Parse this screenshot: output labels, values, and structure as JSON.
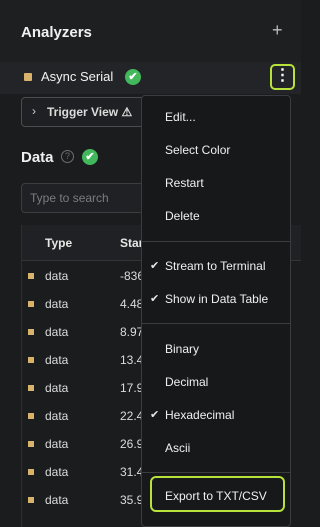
{
  "analyzers": {
    "title": "Analyzers",
    "add_icon": "+",
    "item": {
      "name": "Async Serial",
      "swatch_color": "#d9b36c",
      "status_icon": "check-circle-icon"
    },
    "more_icon": "⋮"
  },
  "trigger_view": {
    "label": "Trigger View ⚠"
  },
  "data_section": {
    "title": "Data",
    "help_icon": "?",
    "search_placeholder": "Type to search",
    "columns": [
      "Type",
      "Star"
    ],
    "rows": [
      {
        "type": "data",
        "start": "-836"
      },
      {
        "type": "data",
        "start": "4.48"
      },
      {
        "type": "data",
        "start": "8.97"
      },
      {
        "type": "data",
        "start": "13.4"
      },
      {
        "type": "data",
        "start": "17.9"
      },
      {
        "type": "data",
        "start": "22.4"
      },
      {
        "type": "data",
        "start": "26.9"
      },
      {
        "type": "data",
        "start": "31.4"
      },
      {
        "type": "data",
        "start": "35.9"
      }
    ]
  },
  "menu": {
    "items": [
      {
        "label": "Edit...",
        "checked": false
      },
      {
        "label": "Select Color",
        "checked": false
      },
      {
        "label": "Restart",
        "checked": false
      },
      {
        "label": "Delete",
        "checked": false
      },
      {
        "label": "Stream to Terminal",
        "checked": true
      },
      {
        "label": "Show in Data Table",
        "checked": true
      },
      {
        "label": "Binary",
        "checked": false
      },
      {
        "label": "Decimal",
        "checked": false
      },
      {
        "label": "Hexadecimal",
        "checked": true
      },
      {
        "label": "Ascii",
        "checked": false
      }
    ],
    "export_label": "Export to TXT/CSV",
    "check_glyph": "✔"
  },
  "colors": {
    "accent_highlight": "#b7e23c",
    "status_green": "#43b75b",
    "data_swatch": "#d9b36c"
  }
}
